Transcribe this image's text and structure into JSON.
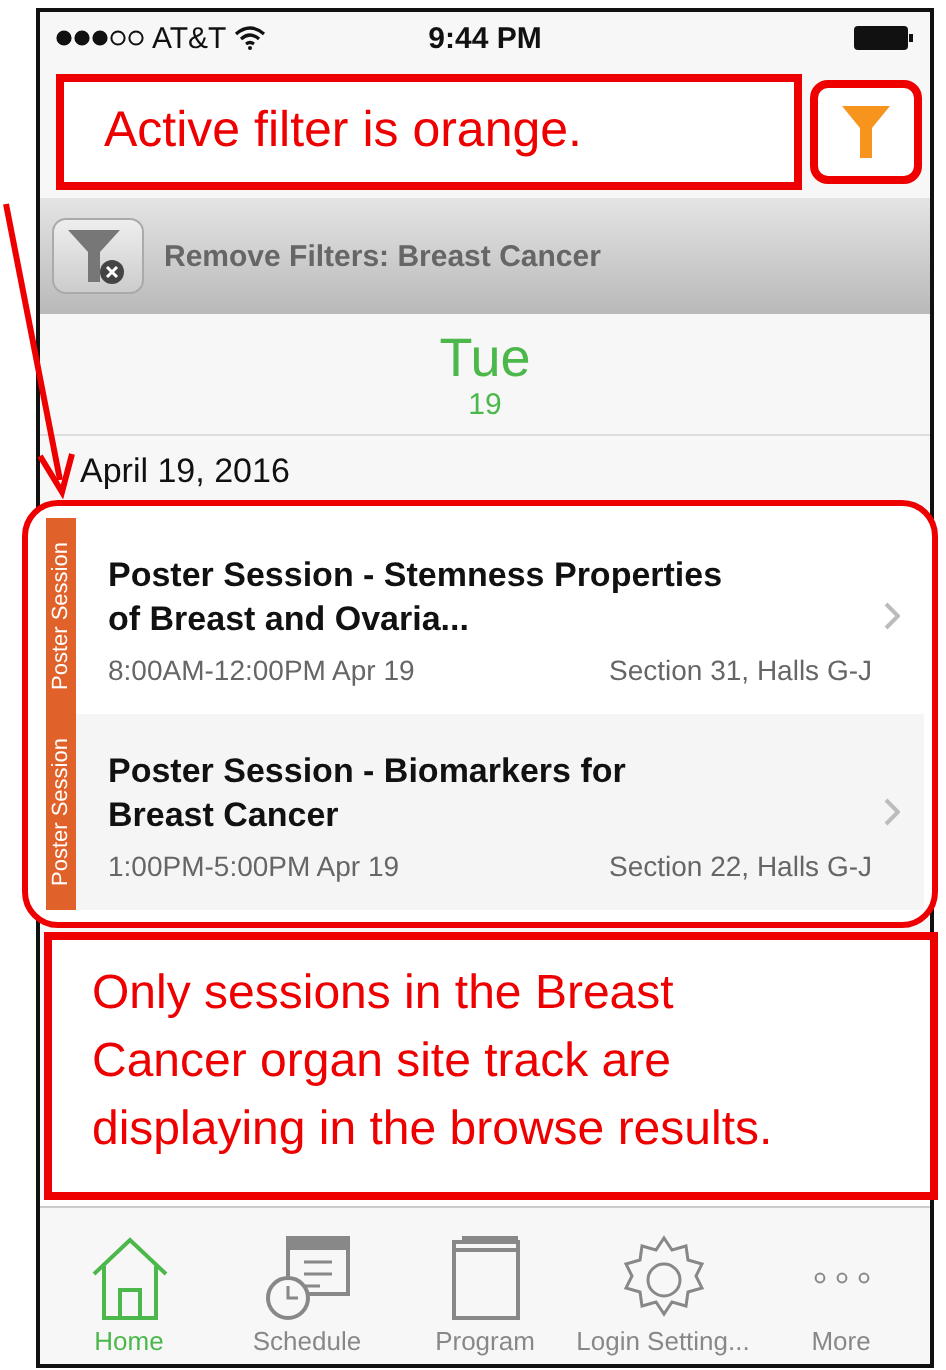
{
  "status_bar": {
    "carrier": "AT&T",
    "time": "9:44 PM"
  },
  "annotations": [
    {
      "text": "Active filter is orange."
    },
    {
      "text": "Only sessions in the Breast Cancer organ site track are displaying in the browse results."
    }
  ],
  "filter_button": {
    "active": true
  },
  "filter_bar": {
    "label": "Remove Filters: Breast Cancer"
  },
  "day_header": {
    "weekday": "Tue",
    "day": "19"
  },
  "date_heading": "April 19, 2016",
  "sessions": [
    {
      "tag": "Poster Session",
      "title": "Poster Session - Stemness Properties of Breast and Ovaria...",
      "time": "8:00AM-12:00PM  Apr 19",
      "location": "Section 31, Halls G-J"
    },
    {
      "tag": "Poster Session",
      "title": "Poster Session - Biomarkers for Breast Cancer",
      "time": "1:00PM-5:00PM  Apr 19",
      "location": "Section 22, Halls G-J"
    }
  ],
  "tabs": [
    {
      "label": "Home",
      "selected": true,
      "kind": "home"
    },
    {
      "label": "Schedule",
      "selected": false,
      "kind": "schedule"
    },
    {
      "label": "Program",
      "selected": false,
      "kind": "program"
    },
    {
      "label": "Login Setting...",
      "selected": false,
      "kind": "settings"
    },
    {
      "label": "More",
      "selected": false,
      "kind": "more"
    }
  ]
}
